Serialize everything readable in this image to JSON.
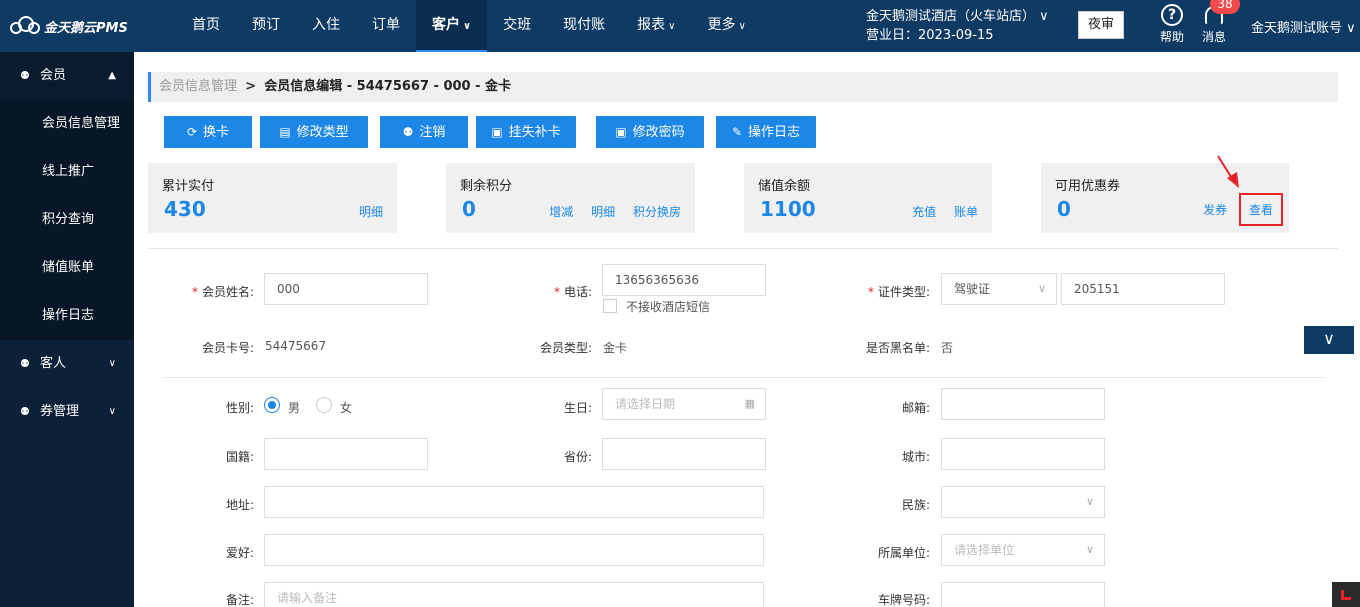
{
  "app": {
    "logo_text": "金天鹅云PMS"
  },
  "nav": {
    "items": [
      {
        "label": "首页"
      },
      {
        "label": "预订"
      },
      {
        "label": "入住"
      },
      {
        "label": "订单"
      },
      {
        "label": "客户",
        "caret": "∨"
      },
      {
        "label": "交班"
      },
      {
        "label": "现付账"
      },
      {
        "label": "报表",
        "caret": "∨"
      },
      {
        "label": "更多",
        "caret": "∨"
      }
    ],
    "hotel_name": "金天鹅测试酒店（火车站店） ∨",
    "business_date": "营业日：2023-09-15",
    "night_audit": "夜审",
    "help_label": "帮助",
    "message_label": "消息",
    "message_count": "38",
    "account": "金天鹅测试账号 ∨"
  },
  "sidebar": {
    "groups": [
      {
        "label": "会员",
        "arrow": "▲",
        "items": [
          "会员信息管理",
          "线上推广",
          "积分查询",
          "储值账单",
          "操作日志"
        ]
      },
      {
        "label": "客人",
        "arrow": "∨"
      },
      {
        "label": "券管理",
        "arrow": "∨"
      }
    ]
  },
  "breadcrumb": {
    "parent": "会员信息管理",
    "separator": ">",
    "current": "会员信息编辑 - 54475667 - 000 - 金卡"
  },
  "actions": [
    "换卡",
    "修改类型",
    "注销",
    "挂失补卡",
    "修改密码",
    "操作日志"
  ],
  "stats": [
    {
      "label": "累计实付",
      "value": "430",
      "links": [
        "明细"
      ]
    },
    {
      "label": "剩余积分",
      "value": "0",
      "links": [
        "增减",
        "明细",
        "积分换房"
      ]
    },
    {
      "label": "储值余额",
      "value": "1100",
      "links": [
        "充值",
        "账单"
      ]
    },
    {
      "label": "可用优惠券",
      "value": "0",
      "links": [
        "发券",
        "查看"
      ]
    }
  ],
  "form": {
    "name_label": "会员姓名:",
    "name_value": "000",
    "phone_label": "电话:",
    "phone_value": "13656365636",
    "sms_opt_out": "不接收酒店短信",
    "id_type_label": "证件类型:",
    "id_type_value": "驾驶证",
    "id_number": "205151",
    "card_no_label": "会员卡号:",
    "card_no_value": "54475667",
    "member_type_label": "会员类型:",
    "member_type_value": "金卡",
    "blacklist_label": "是否黑名单:",
    "blacklist_value": "否",
    "gender_label": "性别:",
    "gender_male": "男",
    "gender_female": "女",
    "birthday_label": "生日:",
    "birthday_placeholder": "请选择日期",
    "email_label": "邮箱:",
    "nationality_label": "国籍:",
    "province_label": "省份:",
    "city_label": "城市:",
    "address_label": "地址:",
    "ethnicity_label": "民族:",
    "hobby_label": "爱好:",
    "company_label": "所属单位:",
    "company_placeholder": "请选择单位",
    "remark_label": "备注:",
    "remark_placeholder": "请输入备注",
    "plate_label": "车牌号码:"
  },
  "colors": {
    "nav_bg": "#0f3a63",
    "sidebar_bg": "#0c2137",
    "accent": "#1c87e6",
    "highlight": "#e8222a"
  }
}
